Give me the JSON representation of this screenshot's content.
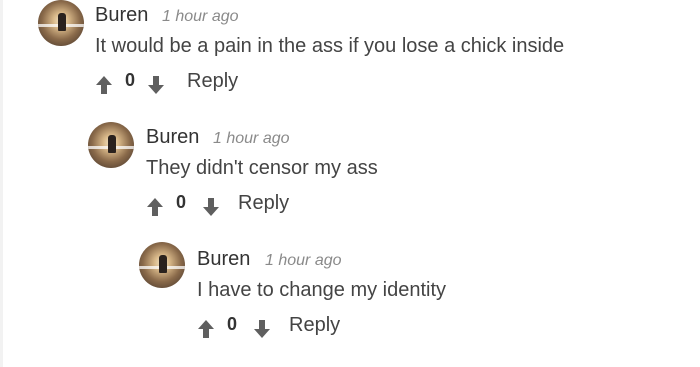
{
  "comments": [
    {
      "author": "Buren",
      "time": "1 hour ago",
      "text": "It would be a pain in the ass if you lose a chick inside",
      "votes": "0",
      "reply_label": "Reply",
      "avatar_icon": "avatar-sunset-icon"
    },
    {
      "author": "Buren",
      "time": "1 hour ago",
      "text": "They didn't censor my ass",
      "votes": "0",
      "reply_label": "Reply",
      "avatar_icon": "avatar-sunset-icon"
    },
    {
      "author": "Buren",
      "time": "1 hour ago",
      "text": "I have to change my identity",
      "votes": "0",
      "reply_label": "Reply",
      "avatar_icon": "avatar-sunset-icon"
    }
  ],
  "icons": {
    "upvote": "arrow-up-icon",
    "downvote": "arrow-down-icon"
  },
  "colors": {
    "arrow": "#5f5f5f",
    "text": "#444444",
    "timestamp": "#8a8a8a"
  }
}
